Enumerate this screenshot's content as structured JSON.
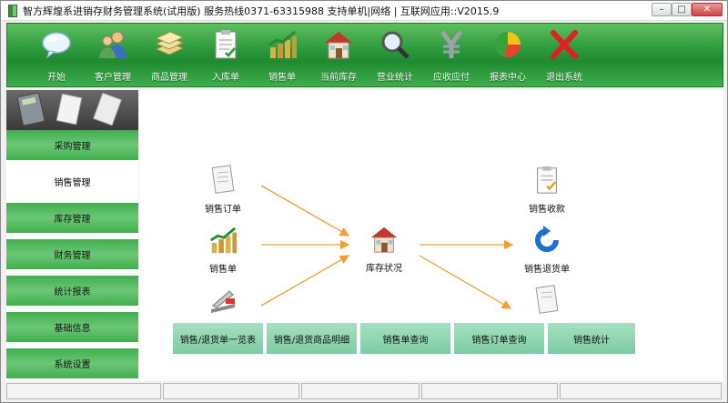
{
  "window": {
    "title": "智方辉煌系进销存财务管理系统(试用版) 服务热线0371-63315988 支持单机|网络 | 互联网应用::V2015.9",
    "min_glyph": "–",
    "max_glyph": "□",
    "close_glyph": "✕"
  },
  "toolbar": {
    "items": [
      {
        "label": "开始",
        "icon": "chat-bubble-icon"
      },
      {
        "label": "客户管理",
        "icon": "users-icon"
      },
      {
        "label": "商品管理",
        "icon": "stack-icon"
      },
      {
        "label": "入库单",
        "icon": "clipboard-icon"
      },
      {
        "label": "销售单",
        "icon": "bar-chart-icon"
      },
      {
        "label": "当前库存",
        "icon": "house-icon"
      },
      {
        "label": "营业统计",
        "icon": "magnifier-icon"
      },
      {
        "label": "应收应付",
        "icon": "yen-icon"
      },
      {
        "label": "报表中心",
        "icon": "pie-chart-icon"
      },
      {
        "label": "退出系统",
        "icon": "exit-x-icon"
      }
    ]
  },
  "sidebar": {
    "items": [
      {
        "label": "采购管理",
        "active": false
      },
      {
        "label": "销售管理",
        "active": true
      },
      {
        "label": "库存管理",
        "active": false
      },
      {
        "label": "财务管理",
        "active": false
      },
      {
        "label": "统计报表",
        "active": false
      },
      {
        "label": "基础信息",
        "active": false
      },
      {
        "label": "系统设置",
        "active": false
      }
    ]
  },
  "flow": {
    "nodes": {
      "sales_order": "销售订单",
      "sales_slip": "销售单",
      "stock_status": "库存状况",
      "sales_receipt": "销售收款",
      "sales_return": "销售退货单"
    },
    "arrow_color": "#f0a030"
  },
  "quick_buttons": [
    "销售/退货单一览表",
    "销售/退货商品明细",
    "销售单查询",
    "销售订单查询",
    "销售统计"
  ],
  "colors": {
    "toolbar_green": "#2e9a3e",
    "quick_button": "#90d6b3"
  }
}
